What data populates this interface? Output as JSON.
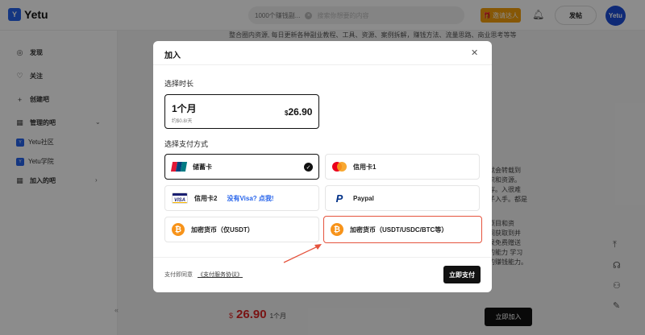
{
  "brand": {
    "name": "Yetu",
    "mark": "Y"
  },
  "topbar": {
    "search_value": "1000个赚钱副...",
    "search_placeholder": "搜索你想要的内容",
    "invite_label": "邀请达人",
    "post_label": "发帖",
    "avatar_text": "Yetu"
  },
  "sidebar": {
    "items": [
      {
        "label": "发现"
      },
      {
        "label": "关注"
      },
      {
        "label": "创建吧"
      },
      {
        "label": "管理的吧"
      },
      {
        "label": "Yetu社区"
      },
      {
        "label": "Yetu学院"
      },
      {
        "label": "加入的吧"
      }
    ]
  },
  "background": {
    "intro_text": "整合圈内资源, 每日更新各种副业教程、工具、资源、案例拆解，赚钱方法、流量思路、商业思考等等",
    "right_lines": [
      "就会转载到",
      "识和资源。",
      "存。入很难",
      "子入手。都是",
      "项目和资",
      "间获取到并",
      "录免费赠送",
      "的能力 学习",
      "的赚钱能力。"
    ],
    "price_currency": "$",
    "price_value": "26.90",
    "price_period": "1个月",
    "join_label": "立即加入"
  },
  "modal": {
    "title": "加入",
    "duration_label": "选择时长",
    "plan": {
      "name": "1个月",
      "sub": "约$0.8/天",
      "currency": "$",
      "price": "26.90"
    },
    "payment_label": "选择支付方式",
    "payments": [
      {
        "label": "储蓄卡",
        "icon": "unionpay-icon",
        "selected": true
      },
      {
        "label": "信用卡1",
        "icon": "mastercard-icon"
      },
      {
        "label": "信用卡2",
        "icon": "visa-icon",
        "link": "没有Visa? 点我!"
      },
      {
        "label": "Paypal",
        "icon": "paypal-icon"
      },
      {
        "label": "加密货币（仅USDT）",
        "icon": "bitcoin-icon"
      },
      {
        "label": "加密货币（USDT/USDC/BTC等）",
        "icon": "bitcoin-icon",
        "highlighted": true
      }
    ],
    "agree_prefix": "支付即同意",
    "agree_link": "《支付服务协议》",
    "pay_button": "立即支付"
  },
  "colors": {
    "accent_red": "#dc2626",
    "highlight_border": "#e5533d",
    "brand_blue": "#2563eb",
    "bitcoin_orange": "#f7931a"
  }
}
